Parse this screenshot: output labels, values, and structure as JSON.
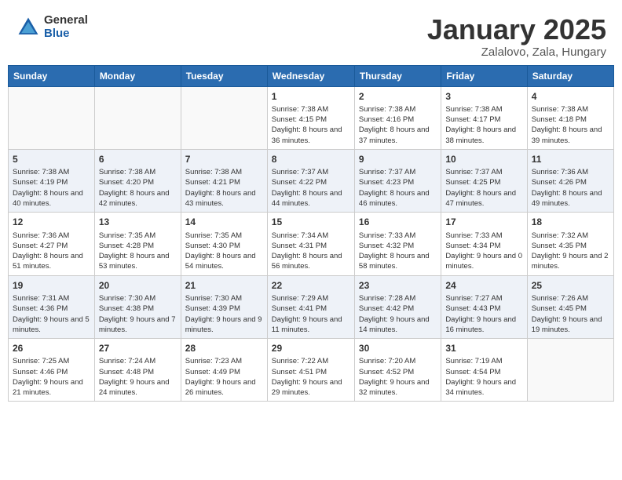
{
  "header": {
    "logo_general": "General",
    "logo_blue": "Blue",
    "month_title": "January 2025",
    "location": "Zalalovo, Zala, Hungary"
  },
  "weekdays": [
    "Sunday",
    "Monday",
    "Tuesday",
    "Wednesday",
    "Thursday",
    "Friday",
    "Saturday"
  ],
  "weeks": [
    [
      {
        "day": "",
        "info": ""
      },
      {
        "day": "",
        "info": ""
      },
      {
        "day": "",
        "info": ""
      },
      {
        "day": "1",
        "info": "Sunrise: 7:38 AM\nSunset: 4:15 PM\nDaylight: 8 hours and 36 minutes."
      },
      {
        "day": "2",
        "info": "Sunrise: 7:38 AM\nSunset: 4:16 PM\nDaylight: 8 hours and 37 minutes."
      },
      {
        "day": "3",
        "info": "Sunrise: 7:38 AM\nSunset: 4:17 PM\nDaylight: 8 hours and 38 minutes."
      },
      {
        "day": "4",
        "info": "Sunrise: 7:38 AM\nSunset: 4:18 PM\nDaylight: 8 hours and 39 minutes."
      }
    ],
    [
      {
        "day": "5",
        "info": "Sunrise: 7:38 AM\nSunset: 4:19 PM\nDaylight: 8 hours and 40 minutes."
      },
      {
        "day": "6",
        "info": "Sunrise: 7:38 AM\nSunset: 4:20 PM\nDaylight: 8 hours and 42 minutes."
      },
      {
        "day": "7",
        "info": "Sunrise: 7:38 AM\nSunset: 4:21 PM\nDaylight: 8 hours and 43 minutes."
      },
      {
        "day": "8",
        "info": "Sunrise: 7:37 AM\nSunset: 4:22 PM\nDaylight: 8 hours and 44 minutes."
      },
      {
        "day": "9",
        "info": "Sunrise: 7:37 AM\nSunset: 4:23 PM\nDaylight: 8 hours and 46 minutes."
      },
      {
        "day": "10",
        "info": "Sunrise: 7:37 AM\nSunset: 4:25 PM\nDaylight: 8 hours and 47 minutes."
      },
      {
        "day": "11",
        "info": "Sunrise: 7:36 AM\nSunset: 4:26 PM\nDaylight: 8 hours and 49 minutes."
      }
    ],
    [
      {
        "day": "12",
        "info": "Sunrise: 7:36 AM\nSunset: 4:27 PM\nDaylight: 8 hours and 51 minutes."
      },
      {
        "day": "13",
        "info": "Sunrise: 7:35 AM\nSunset: 4:28 PM\nDaylight: 8 hours and 53 minutes."
      },
      {
        "day": "14",
        "info": "Sunrise: 7:35 AM\nSunset: 4:30 PM\nDaylight: 8 hours and 54 minutes."
      },
      {
        "day": "15",
        "info": "Sunrise: 7:34 AM\nSunset: 4:31 PM\nDaylight: 8 hours and 56 minutes."
      },
      {
        "day": "16",
        "info": "Sunrise: 7:33 AM\nSunset: 4:32 PM\nDaylight: 8 hours and 58 minutes."
      },
      {
        "day": "17",
        "info": "Sunrise: 7:33 AM\nSunset: 4:34 PM\nDaylight: 9 hours and 0 minutes."
      },
      {
        "day": "18",
        "info": "Sunrise: 7:32 AM\nSunset: 4:35 PM\nDaylight: 9 hours and 2 minutes."
      }
    ],
    [
      {
        "day": "19",
        "info": "Sunrise: 7:31 AM\nSunset: 4:36 PM\nDaylight: 9 hours and 5 minutes."
      },
      {
        "day": "20",
        "info": "Sunrise: 7:30 AM\nSunset: 4:38 PM\nDaylight: 9 hours and 7 minutes."
      },
      {
        "day": "21",
        "info": "Sunrise: 7:30 AM\nSunset: 4:39 PM\nDaylight: 9 hours and 9 minutes."
      },
      {
        "day": "22",
        "info": "Sunrise: 7:29 AM\nSunset: 4:41 PM\nDaylight: 9 hours and 11 minutes."
      },
      {
        "day": "23",
        "info": "Sunrise: 7:28 AM\nSunset: 4:42 PM\nDaylight: 9 hours and 14 minutes."
      },
      {
        "day": "24",
        "info": "Sunrise: 7:27 AM\nSunset: 4:43 PM\nDaylight: 9 hours and 16 minutes."
      },
      {
        "day": "25",
        "info": "Sunrise: 7:26 AM\nSunset: 4:45 PM\nDaylight: 9 hours and 19 minutes."
      }
    ],
    [
      {
        "day": "26",
        "info": "Sunrise: 7:25 AM\nSunset: 4:46 PM\nDaylight: 9 hours and 21 minutes."
      },
      {
        "day": "27",
        "info": "Sunrise: 7:24 AM\nSunset: 4:48 PM\nDaylight: 9 hours and 24 minutes."
      },
      {
        "day": "28",
        "info": "Sunrise: 7:23 AM\nSunset: 4:49 PM\nDaylight: 9 hours and 26 minutes."
      },
      {
        "day": "29",
        "info": "Sunrise: 7:22 AM\nSunset: 4:51 PM\nDaylight: 9 hours and 29 minutes."
      },
      {
        "day": "30",
        "info": "Sunrise: 7:20 AM\nSunset: 4:52 PM\nDaylight: 9 hours and 32 minutes."
      },
      {
        "day": "31",
        "info": "Sunrise: 7:19 AM\nSunset: 4:54 PM\nDaylight: 9 hours and 34 minutes."
      },
      {
        "day": "",
        "info": ""
      }
    ]
  ]
}
